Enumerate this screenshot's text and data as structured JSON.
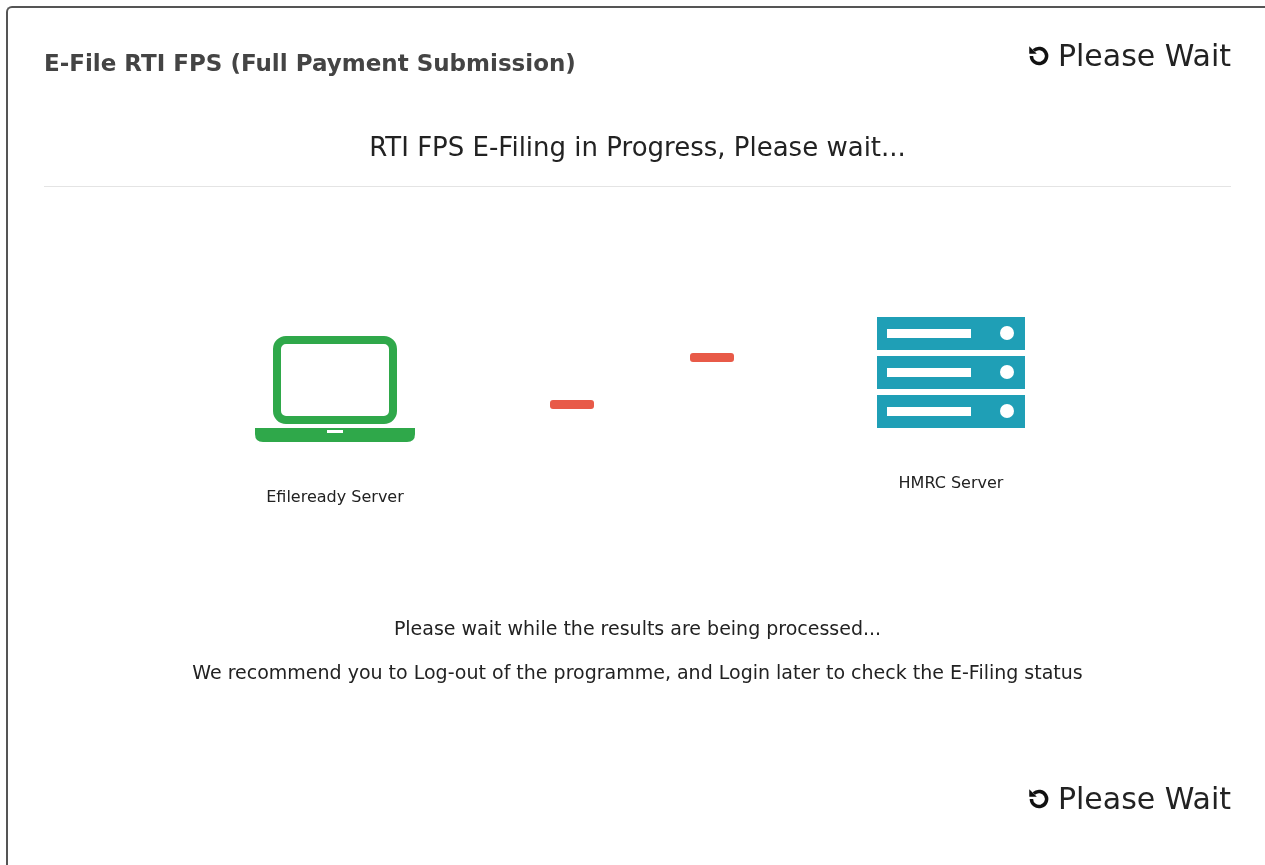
{
  "dialog": {
    "title": "E-File RTI FPS (Full Payment Submission)",
    "top_button": "Please Wait",
    "heading": "RTI FPS E-Filing in Progress, Please wait...",
    "endpoints": [
      {
        "kind": "laptop",
        "label": "Efileready Server"
      },
      {
        "kind": "server",
        "label": "HMRC Server"
      }
    ],
    "messages": [
      "Please wait while the results are being processed...",
      "We recommend you to Log-out of the programme, and Login later to check the E-Filing status"
    ],
    "bottom_button": "Please Wait"
  }
}
